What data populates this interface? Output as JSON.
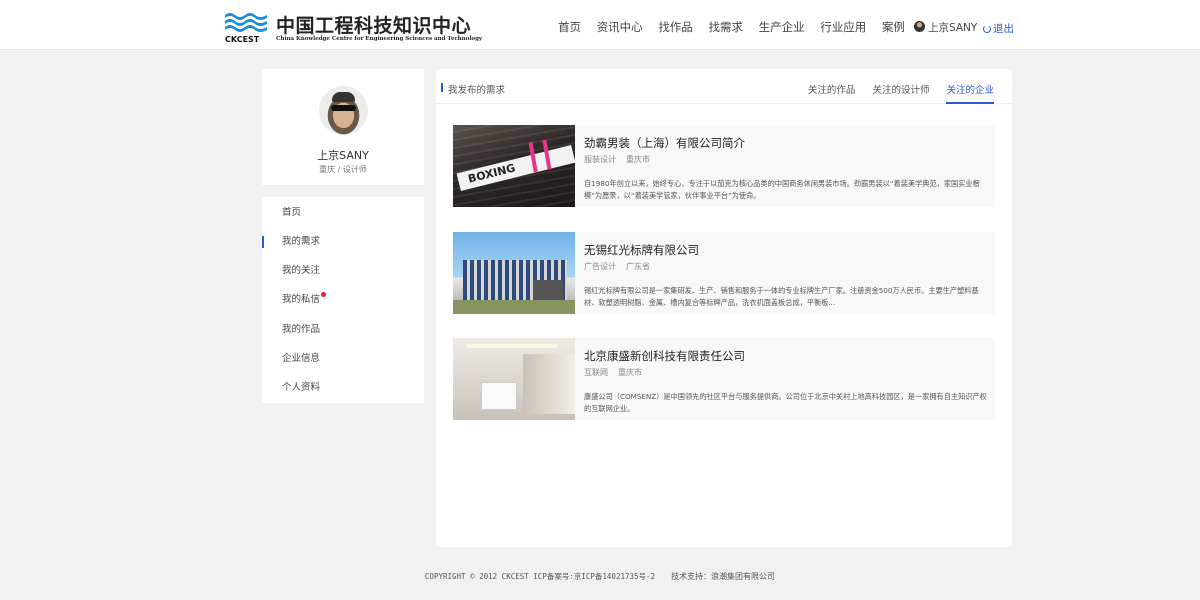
{
  "header": {
    "logo_cn": "中国工程科技知识中心",
    "logo_en": "China Knowledge Centre for Engineering Sciences and Technology",
    "logo_mark": "CKCEST",
    "nav": [
      "首页",
      "资讯中心",
      "找作品",
      "找需求",
      "生产企业",
      "行业应用",
      "案例"
    ],
    "user_name": "上京SANY",
    "logout_label": "退出"
  },
  "profile": {
    "name": "上京SANY",
    "role": "重庆 / 设计师"
  },
  "menu": {
    "items": [
      "首页",
      "我的需求",
      "我的关注",
      "我的私信",
      "我的作品",
      "企业信息",
      "个人资料"
    ],
    "active_index": 1,
    "unread_index": 3
  },
  "main": {
    "section_title": "我发布的需求",
    "tabs": [
      "关注的作品",
      "关注的设计师",
      "关注的企业"
    ],
    "active_tab": 2,
    "cards": [
      {
        "name": "劲霸男装（上海）有限公司简介",
        "tags": [
          "服装设计",
          "重庆市"
        ],
        "desc": "自1980年创立以来，始终专心、专注于以茄克为核心品类的中国商务休闲男装市场。劲霸男装以“着装美学典范，家国实业楷模”为愿景，以“着装美学管家，伙伴事业平台”为使命。",
        "thumb_text": "BOXING"
      },
      {
        "name": "无锡红光标牌有限公司",
        "tags": [
          "广告设计",
          "广东省"
        ],
        "desc": "锡红光标牌有限公司是一家集研发、生产、销售和服务于一体的专业标牌生产厂家。注册资金500万人民币。主要生产塑料基材、软塑透明树脂、金属、槽内复合等标牌产品，洗衣机面盖板总成，平衡板..."
      },
      {
        "name": "北京康盛新创科技有限责任公司",
        "tags": [
          "互联网",
          "重庆市"
        ],
        "desc": "康盛公司（COMSENZ）是中国领先的社区平台与服务提供商。公司位于北京中关村上地高科技园区，是一家拥有自主知识产权的互联网企业。"
      }
    ]
  },
  "footer": {
    "copyright": "COPYRIGHT © 2012 CKCEST ICP备案号:京ICP备14021735号-2",
    "support": "技术支持：浪潮集团有限公司"
  },
  "colors": {
    "accent": "#2a5bd7",
    "background": "#f1f1f1",
    "unread_dot": "#e02828"
  }
}
